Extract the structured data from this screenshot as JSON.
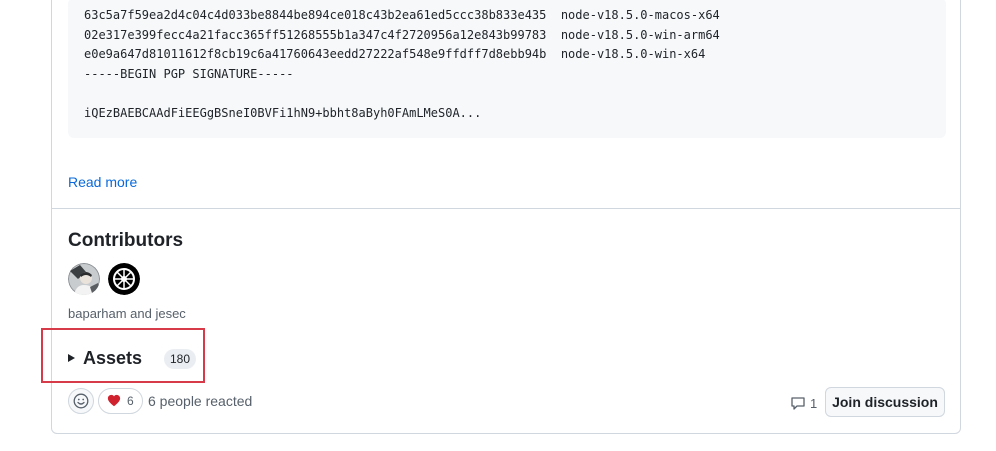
{
  "code_block": {
    "lines": [
      "63c5a7f59ea2d4c04c4d033be8844be894ce018c43b2ea61ed5ccc38b833e435  node-v18.5.0-macos-x64",
      "02e317e399fecc4a21facc365ff51268555b1a347c4f2720956a12e843b99783  node-v18.5.0-win-arm64",
      "e0e9a647d81011612f8cb19c6a41760643eedd27222af548e9ffdff7d8ebb94b  node-v18.5.0-win-x64",
      "-----BEGIN PGP SIGNATURE-----",
      "",
      "iQEzBAEBCAAdFiEEGgBSneI0BVFi1hN9+bbht8aByh0FAmLMeS0A..."
    ]
  },
  "read_more": "Read more",
  "contributors": {
    "title": "Contributors",
    "avatars": [
      {
        "name": "baparham",
        "icon": "avatar-photo"
      },
      {
        "name": "jesec",
        "icon": "avatar-wheel-logo"
      }
    ],
    "names_text": "baparham and jesec"
  },
  "assets": {
    "label": "Assets",
    "count": "180"
  },
  "reactions": {
    "emoji_icon": "smiley-icon",
    "heart_icon": "heart-icon",
    "heart_count": "6",
    "reacted_text": "6 people reacted",
    "heart_color": "#cf222e"
  },
  "discussion": {
    "comment_icon": "comment-icon",
    "comment_count": "1",
    "join_label": "Join discussion"
  },
  "colors": {
    "link": "#0969da",
    "highlight_border": "#d73a49"
  }
}
